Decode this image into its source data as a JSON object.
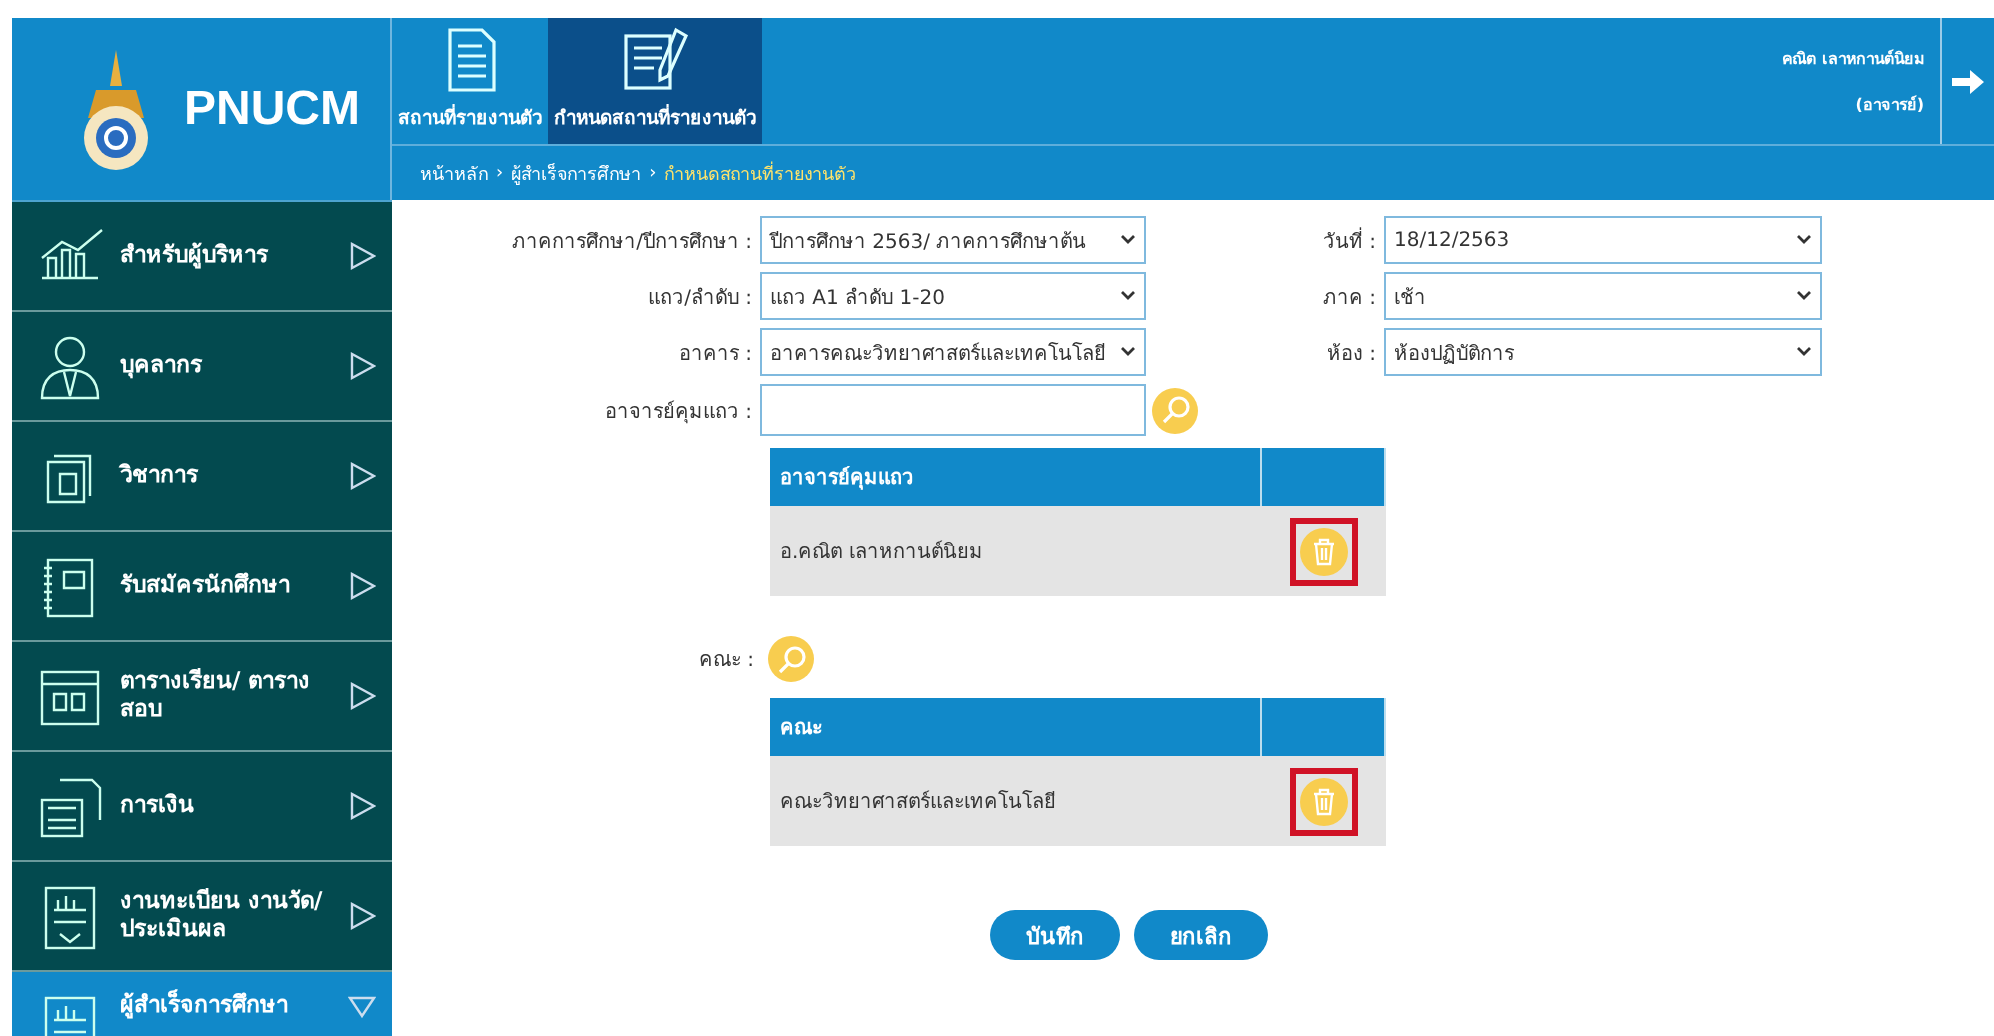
{
  "header": {
    "logo_text": "PNUCM",
    "tabs": [
      {
        "label": "สถานที่รายงานตัว",
        "selected": false
      },
      {
        "label": "กำหนดสถานที่รายงานตัว",
        "selected": true
      }
    ],
    "breadcrumb_separator": "›",
    "breadcrumb": [
      {
        "label": "หน้าหลัก",
        "current": false
      },
      {
        "label": "ผู้สำเร็จการศึกษา",
        "current": false
      },
      {
        "label": "กำหนดสถานที่รายงานตัว",
        "current": true
      }
    ],
    "user": {
      "name": "คณิต เลาหกานต์นิยม",
      "role": "(อาจารย์)"
    }
  },
  "sidebar": {
    "items": [
      {
        "label": "สำหรับผู้บริหาร",
        "selected": false,
        "expanded": false
      },
      {
        "label": "บุคลากร",
        "selected": false,
        "expanded": false
      },
      {
        "label": "วิชาการ",
        "selected": false,
        "expanded": false
      },
      {
        "label": "รับสมัครนักศึกษา",
        "selected": false,
        "expanded": false
      },
      {
        "label": "ตารางเรียน/ ตารางสอบ",
        "selected": false,
        "expanded": false
      },
      {
        "label": "การเงิน",
        "selected": false,
        "expanded": false
      },
      {
        "label": "งานทะเบียน งานวัด/ประเมินผล",
        "selected": false,
        "expanded": false
      },
      {
        "label": "ผู้สำเร็จการศึกษา",
        "selected": true,
        "expanded": true
      }
    ]
  },
  "form": {
    "left_fields": [
      {
        "label": "ภาคการศึกษา/ปีการศึกษา :",
        "value": "ปีการศึกษา 2563/ ภาคการศึกษาต้น",
        "kind": "select"
      },
      {
        "label": "แถว/ลำดับ :",
        "value": "แถว A1 ลำดับ 1-20",
        "kind": "select"
      },
      {
        "label": "อาคาร :",
        "value": "อาคารคณะวิทยาศาสตร์และเทคโนโลยี",
        "kind": "select"
      },
      {
        "label": "อาจารย์คุมแถว :",
        "kind": "search"
      }
    ],
    "right_fields": [
      {
        "label": "วันที่ :",
        "value": "18/12/2563",
        "kind": "select"
      },
      {
        "label": "ภาค :",
        "value": "เช้า",
        "kind": "select"
      },
      {
        "label": "ห้อง :",
        "value": "ห้องปฏิบัติการ",
        "kind": "select"
      }
    ],
    "supervisor_table": {
      "columns": [
        "อาจารย์คุมแถว"
      ],
      "rows": [
        {
          "name": "อ.คณิต เลาหกานต์นิยม",
          "highlighted": true
        }
      ]
    },
    "faculty_label": "คณะ :",
    "faculty_table": {
      "columns": [
        "คณะ"
      ],
      "rows": [
        {
          "name": "คณะวิทยาศาสตร์และเทคโนโลยี",
          "highlighted": true
        }
      ]
    },
    "buttons": [
      "บันทึก",
      "ยกเลิก"
    ]
  }
}
